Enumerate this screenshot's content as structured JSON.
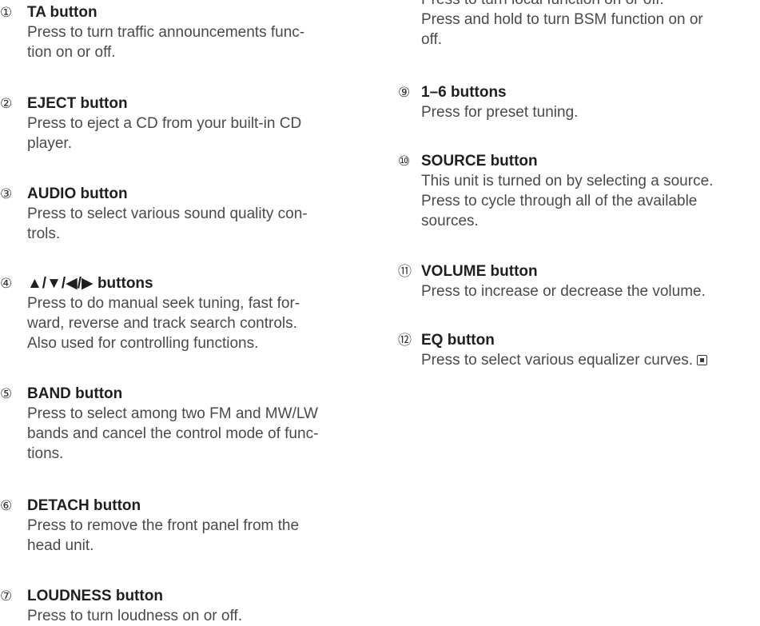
{
  "left_entries": [
    {
      "num": "①",
      "title": "TA button",
      "lines": [
        "Press to turn traffic announcements func-",
        "tion on or off."
      ]
    },
    {
      "num": "②",
      "title": "EJECT button",
      "lines": [
        "Press to eject a CD from your built-in CD",
        "player."
      ]
    },
    {
      "num": "③",
      "title": "AUDIO button",
      "lines": [
        "Press to select various sound quality con-",
        "trols."
      ]
    },
    {
      "num": "④",
      "title": "▲/▼/◀/▶ buttons",
      "lines": [
        "Press to do manual seek tuning, fast for-",
        "ward, reverse and track search controls.",
        "Also used for controlling functions."
      ]
    },
    {
      "num": "⑤",
      "title": "BAND button",
      "lines": [
        "Press to select among two FM and MW/LW",
        "bands and cancel the control mode of func-",
        "tions."
      ]
    },
    {
      "num": "⑥",
      "title": "DETACH button",
      "lines": [
        "Press to remove the front panel from the",
        "head unit."
      ]
    },
    {
      "num": "⑦",
      "title": "LOUDNESS button",
      "lines": [
        "Press to turn loudness on or off."
      ]
    }
  ],
  "right_top_lines": [
    "Press to turn local function on or off.",
    "Press and hold to turn BSM function on or",
    "off."
  ],
  "right_entries": [
    {
      "num": "⑨",
      "title": "1–6 buttons",
      "lines": [
        "Press for preset tuning."
      ]
    },
    {
      "num": "⑩",
      "title": "SOURCE button",
      "lines": [
        "This unit is turned on by selecting a source.",
        "Press to cycle through all of the available",
        "sources."
      ]
    },
    {
      "num": "⑪",
      "title": "VOLUME button",
      "lines": [
        "Press to increase or decrease the volume."
      ]
    },
    {
      "num": "⑫",
      "title": "EQ button",
      "lines": [
        "Press to select various equalizer curves."
      ]
    }
  ],
  "end_mark_icon": "end-of-section-square-icon"
}
